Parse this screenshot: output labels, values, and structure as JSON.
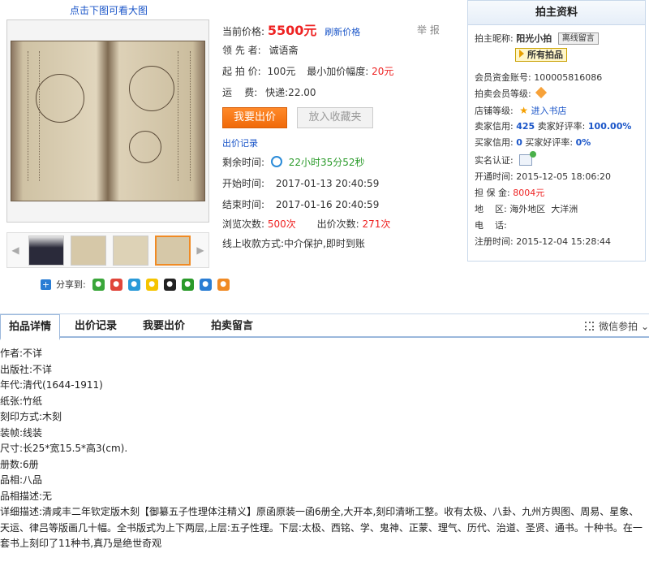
{
  "gallery_hint": "点击下图可看大图",
  "share": {
    "label": "分享到:",
    "icons": [
      "wechat-icon",
      "weibo-icon",
      "tencent-weibo-icon",
      "qzone-icon",
      "qq-icon",
      "douban-icon",
      "renren-icon",
      "kaixin-icon"
    ]
  },
  "auction": {
    "price_label": "当前价格:",
    "price": "5500元",
    "refresh": "刷新价格",
    "report": "举 报",
    "leader_label": "领 先 者:",
    "leader": "诚语斋",
    "start_price_label": "起 拍 价:",
    "start_price": "100元",
    "min_increment_label": "最小加价幅度:",
    "min_increment": "20元",
    "shipping_label": "运    费:",
    "shipping": "快递:22.00",
    "bid_button": "我要出价",
    "fav_button": "放入收藏夹",
    "bid_record_link": "出价记录",
    "remaining_label": "剩余时间:",
    "remaining": "22小时35分52秒",
    "start_time_label": "开始时间:",
    "start_time": "2017-01-13 20:40:59",
    "end_time_label": "结束时间:",
    "end_time": "2017-01-16 20:40:59",
    "views_label": "浏览次数:",
    "views": "500次",
    "bids_label": "出价次数:",
    "bids": "271次",
    "payment": "线上收款方式:中介保护,即时到账"
  },
  "seller": {
    "title": "拍主资料",
    "nickname_label": "拍主昵称:",
    "nickname": "阳光小拍",
    "offline_msg": "离线留言",
    "all_items": "所有拍品",
    "account_label": "会员资金账号:",
    "account": "100005816086",
    "level_label": "拍卖会员等级:",
    "shop_label": "店铺等级:",
    "shop_link": "进入书店",
    "seller_credit_label": "卖家信用:",
    "seller_credit": "425",
    "seller_rate_label": "卖家好评率:",
    "seller_rate": "100.00%",
    "buyer_credit_label": "买家信用:",
    "buyer_credit": "0",
    "buyer_rate_label": "买家好评率:",
    "buyer_rate": "0%",
    "verify_label": "实名认证:",
    "open_time_label": "开通时间:",
    "open_time": "2015-12-05 18:06:20",
    "deposit_label": "担 保 金:",
    "deposit": "8004元",
    "region_label": "地    区:",
    "region": "海外地区  大洋洲",
    "phone_label": "电    话:",
    "register_label": "注册时间:",
    "register_time": "2015-12-04 15:28:44"
  },
  "tabs": [
    "拍品详情",
    "出价记录",
    "我要出价",
    "拍卖留言"
  ],
  "wechat_label": "微信参拍",
  "details": [
    "作者:不详",
    "出版社:不详",
    "年代:清代(1644-1911)",
    "纸张:竹纸",
    "刻印方式:木刻",
    "装帧:线装",
    "尺寸:长25*宽15.5*高3(cm).",
    "册数:6册",
    "品相:八品",
    "品相描述:无"
  ],
  "description": "详细描述:清咸丰二年钦定版木刻【御纂五子性理体注精义】原函原装一函6册全,大开本,刻印清晰工整。收有太极、八卦、九州方舆图、周易、星象、天运、律吕等版画几十幅。全书版式为上下两层,上层:五子性理。下层:太极、西铭、学、鬼神、正蒙、理气、历代、治道、圣贤、通书。十种书。在一套书上刻印了11种书,真乃是绝世奇观",
  "colors": {
    "accent": "#e22222",
    "link": "#1a55c8",
    "button": "#f06a0a",
    "border": "#c8d8ea"
  }
}
